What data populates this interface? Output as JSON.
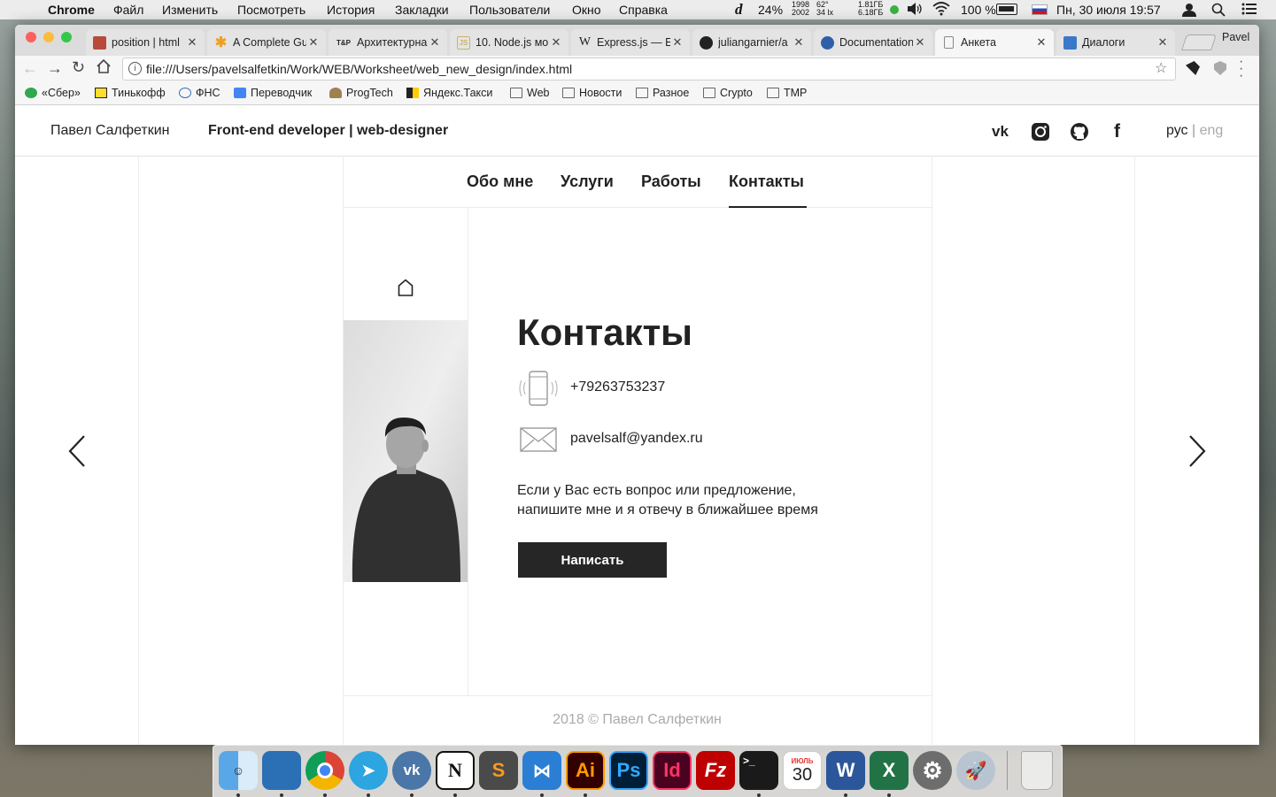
{
  "menubar": {
    "app": "Chrome",
    "items": [
      "Файл",
      "Изменить",
      "Посмотреть",
      "История",
      "Закладки",
      "Пользователи",
      "Окно",
      "Справка"
    ],
    "status": {
      "cpu": "24%",
      "mem_top": "1998",
      "mem_bottom": "2002",
      "temp_top": "62°",
      "temp_bottom": "34 lx",
      "net_top": "1.81ГБ",
      "net_bottom": "6.18ГБ",
      "battery": "100 %",
      "datetime": "Пн, 30 июля  19:57"
    }
  },
  "browser": {
    "profile": "Pavel",
    "tabs": [
      {
        "title": "position | html",
        "icon": "mdn-icon",
        "color": "#b84a3a"
      },
      {
        "title": "A Complete Gu",
        "icon": "asterisk-icon",
        "color": "#f0a020"
      },
      {
        "title": "Архитектурна",
        "icon": "tp-icon",
        "color": "#333333"
      },
      {
        "title": "10. Node.js мо",
        "icon": "book-icon",
        "color": "#c9b36a"
      },
      {
        "title": "Express.js — E",
        "icon": "wikipedia-icon",
        "color": "#333333"
      },
      {
        "title": "juliangarnier/a",
        "icon": "github-icon",
        "color": "#222222"
      },
      {
        "title": "Documentation",
        "icon": "docs-icon",
        "color": "#2f5fa8"
      },
      {
        "title": "Анкета",
        "icon": "page-icon",
        "color": "#888888"
      },
      {
        "title": "Диалоги",
        "icon": "chat-icon",
        "color": "#3a78c9"
      }
    ],
    "url": "file:///Users/pavelsalfetkin/Work/WEB/Worksheet/web_new_design/index.html",
    "bookmarks": [
      {
        "label": "«Сбер»",
        "icon": "sber-icon"
      },
      {
        "label": "Тинькофф",
        "icon": "tinkoff-icon"
      },
      {
        "label": "ФНС",
        "icon": "fns-icon"
      },
      {
        "label": "Переводчик",
        "icon": "translate-icon"
      },
      {
        "label": "ProgTech",
        "icon": "progtech-icon"
      },
      {
        "label": "Яндекс.Такси",
        "icon": "taxi-icon"
      },
      {
        "label": "Web",
        "icon": "folder-icon"
      },
      {
        "label": "Новости",
        "icon": "folder-icon"
      },
      {
        "label": "Разное",
        "icon": "folder-icon"
      },
      {
        "label": "Crypto",
        "icon": "folder-icon"
      },
      {
        "label": "TMP",
        "icon": "folder-icon"
      }
    ]
  },
  "site": {
    "name": "Павел Салфеткин",
    "role": "Front-end developer | web-designer",
    "social": [
      "vk-icon",
      "instagram-icon",
      "github-icon",
      "facebook-icon"
    ],
    "lang_active": "рус",
    "lang_sep": " | ",
    "lang_inactive": "eng",
    "nav": [
      "Обо мне",
      "Услуги",
      "Работы",
      "Контакты"
    ],
    "nav_active": "Контакты",
    "contacts": {
      "title": "Контакты",
      "phone": "+79263753237",
      "email": "pavelsalf@yandex.ru",
      "message_line1": "Если у Вас есть вопрос или предложение,",
      "message_line2": "напишите мне и я отвечу в ближайшее время",
      "button": "Написать"
    },
    "footer": "2018 © Павел Салфеткин"
  },
  "dock": [
    "finder-icon",
    "files-icon",
    "chrome-icon",
    "telegram-icon",
    "vk-icon",
    "notion-icon",
    "sublime-icon",
    "vscode-icon",
    "illustrator-icon",
    "photoshop-icon",
    "indesign-icon",
    "filezilla-icon",
    "terminal-icon",
    "calendar-icon",
    "word-icon",
    "excel-icon",
    "system-preferences-icon",
    "launchpad-icon",
    "trash-icon"
  ],
  "dock_calendar": {
    "month": "ИЮЛЬ",
    "day": "30"
  }
}
